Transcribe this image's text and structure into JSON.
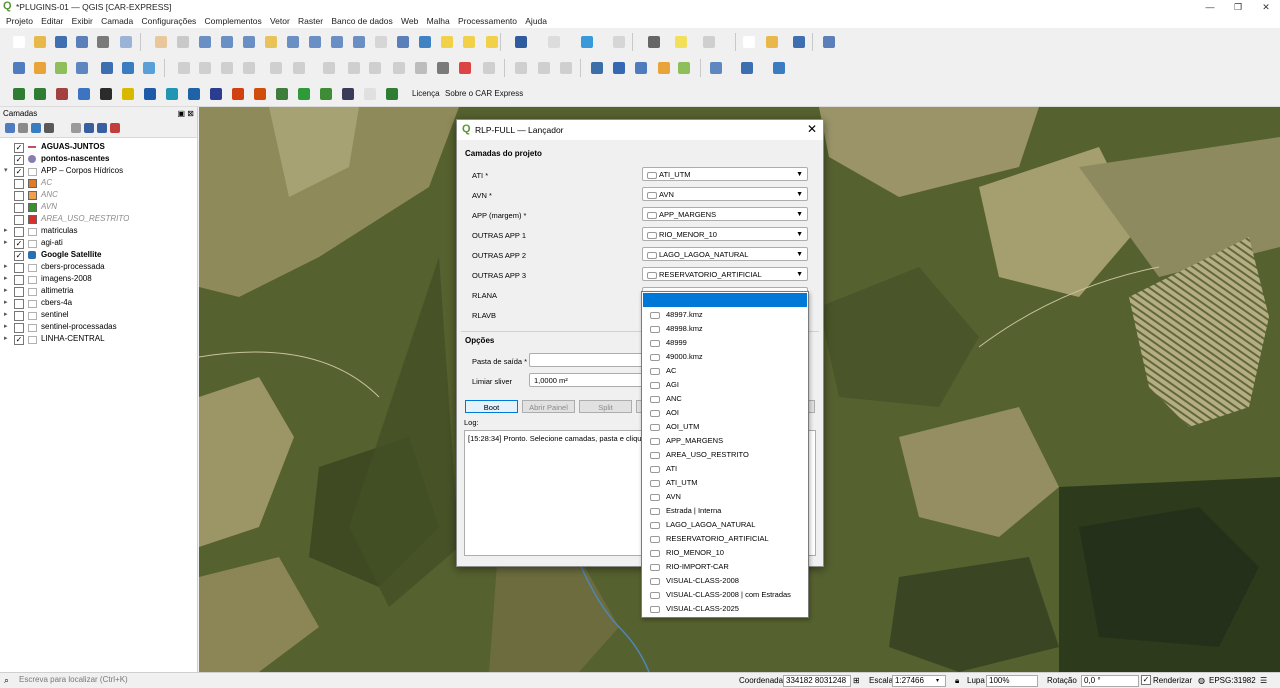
{
  "window": {
    "title": "*PLUGINS-01 — QGIS [CAR-EXPRESS]",
    "minimize": "—",
    "restore": "❐",
    "close": "✕"
  },
  "menu": [
    "Projeto",
    "Editar",
    "Exibir",
    "Camada",
    "Configurações",
    "Complementos",
    "Vetor",
    "Raster",
    "Banco de dados",
    "Web",
    "Malha",
    "Processamento",
    "Ajuda"
  ],
  "toolbar3_links": {
    "license": "Licença",
    "about": "Sobre o CAR Express"
  },
  "layers_panel": {
    "title": "Camadas",
    "items": [
      {
        "name": "AGUAS-JUNTOS",
        "checked": true,
        "bold": true,
        "italic": false,
        "expander": "",
        "icon": "line-icon",
        "color": "#c44d6b"
      },
      {
        "name": "pontos-nascentes",
        "checked": true,
        "bold": true,
        "italic": false,
        "expander": "",
        "icon": "point-icon",
        "color": "#8b7bb3"
      },
      {
        "name": "APP – Corpos Hídricos",
        "checked": true,
        "bold": false,
        "italic": false,
        "expander": "▾",
        "icon": "group-icon",
        "color": "#e8c35a"
      },
      {
        "name": "AC",
        "checked": false,
        "bold": false,
        "italic": true,
        "expander": "",
        "icon": "polygon-icon",
        "color": "#e07b2a"
      },
      {
        "name": "ANC",
        "checked": false,
        "bold": false,
        "italic": true,
        "expander": "",
        "icon": "polygon-icon",
        "color": "#f4a04a"
      },
      {
        "name": "AVN",
        "checked": false,
        "bold": false,
        "italic": true,
        "expander": "",
        "icon": "polygon-icon",
        "color": "#3a8f2e"
      },
      {
        "name": "AREA_USO_RESTRITO",
        "checked": false,
        "bold": false,
        "italic": true,
        "expander": "",
        "icon": "polygon-icon",
        "color": "#d9302c"
      },
      {
        "name": "matriculas",
        "checked": false,
        "bold": false,
        "italic": false,
        "expander": "▸",
        "icon": "group-icon",
        "color": "#e8c35a"
      },
      {
        "name": "agi-ati",
        "checked": true,
        "bold": false,
        "italic": false,
        "expander": "▸",
        "icon": "group-icon",
        "color": "#e8c35a"
      },
      {
        "name": "Google Satellite",
        "checked": true,
        "bold": true,
        "italic": false,
        "expander": "",
        "icon": "xyz-icon",
        "color": "#2a6fb0"
      },
      {
        "name": "cbers-processada",
        "checked": false,
        "bold": false,
        "italic": false,
        "expander": "▸",
        "icon": "group-icon",
        "color": "#e8c35a"
      },
      {
        "name": "imagens-2008",
        "checked": false,
        "bold": false,
        "italic": false,
        "expander": "▸",
        "icon": "group-icon",
        "color": "#e8c35a"
      },
      {
        "name": "altimetria",
        "checked": false,
        "bold": false,
        "italic": false,
        "expander": "▸",
        "icon": "group-icon",
        "color": "#e8c35a"
      },
      {
        "name": "cbers-4a",
        "checked": false,
        "bold": false,
        "italic": false,
        "expander": "▸",
        "icon": "group-icon",
        "color": "#e8c35a"
      },
      {
        "name": "sentinel",
        "checked": false,
        "bold": false,
        "italic": false,
        "expander": "▸",
        "icon": "group-icon",
        "color": "#e8c35a"
      },
      {
        "name": "sentinel-processadas",
        "checked": false,
        "bold": false,
        "italic": false,
        "expander": "▸",
        "icon": "group-icon",
        "color": "#e8c35a"
      },
      {
        "name": "LINHA-CENTRAL",
        "checked": true,
        "bold": false,
        "italic": false,
        "expander": "▸",
        "icon": "group-icon",
        "color": "#e8c35a"
      }
    ]
  },
  "dialog": {
    "title": "RLP-FULL — Lançador",
    "close": "✕",
    "section_layers": "Camadas do projeto",
    "fields": [
      {
        "label": "ATI *",
        "value": "ATI_UTM"
      },
      {
        "label": "AVN *",
        "value": "AVN"
      },
      {
        "label": "APP (margem) *",
        "value": "APP_MARGENS"
      },
      {
        "label": "OUTRAS APP 1",
        "value": "RIO_MENOR_10"
      },
      {
        "label": "OUTRAS APP 2",
        "value": "LAGO_LAGOA_NATURAL"
      },
      {
        "label": "OUTRAS APP 3",
        "value": "RESERVATORIO_ARTIFICIAL"
      },
      {
        "label": "RLANA",
        "value": ""
      },
      {
        "label": "RLAVB",
        "value": ""
      }
    ],
    "section_options": "Opções",
    "output_folder_label": "Pasta de saída *",
    "output_folder_value": "",
    "sliver_label": "Limiar sliver",
    "sliver_value": "1,0000 m²",
    "buttons": [
      "Boot",
      "Abrir Painel",
      "Split"
    ],
    "log_label": "Log:",
    "log_text": "[15:28:34] Pronto. Selecione camadas, pasta e clique B"
  },
  "dropdown": {
    "selected": "",
    "items": [
      "48997.kmz",
      "48998.kmz",
      "48999",
      "49000.kmz",
      "AC",
      "AGI",
      "ANC",
      "AOI",
      "AOI_UTM",
      "APP_MARGENS",
      "AREA_USO_RESTRITO",
      "ATI",
      "ATI_UTM",
      "AVN",
      "Estrada | Interna",
      "LAGO_LAGOA_NATURAL",
      "RESERVATORIO_ARTIFICIAL",
      "RIO_MENOR_10",
      "RIO-IMPORT-CAR",
      "VISUAL-CLASS-2008",
      "VISUAL-CLASS-2008 | com Estradas",
      "VISUAL-CLASS-2025"
    ]
  },
  "statusbar": {
    "locator_placeholder": "Escreva para localizar (Ctrl+K)",
    "coord_label": "Coordenada",
    "coord_value": "334182  8031248",
    "scale_label": "Escala",
    "scale_value": "1:27466",
    "magnifier_label": "Lupa",
    "magnifier_value": "100%",
    "rotation_label": "Rotação",
    "rotation_value": "0,0 °",
    "render_label": "Renderizar",
    "crs": "EPSG:31982"
  }
}
